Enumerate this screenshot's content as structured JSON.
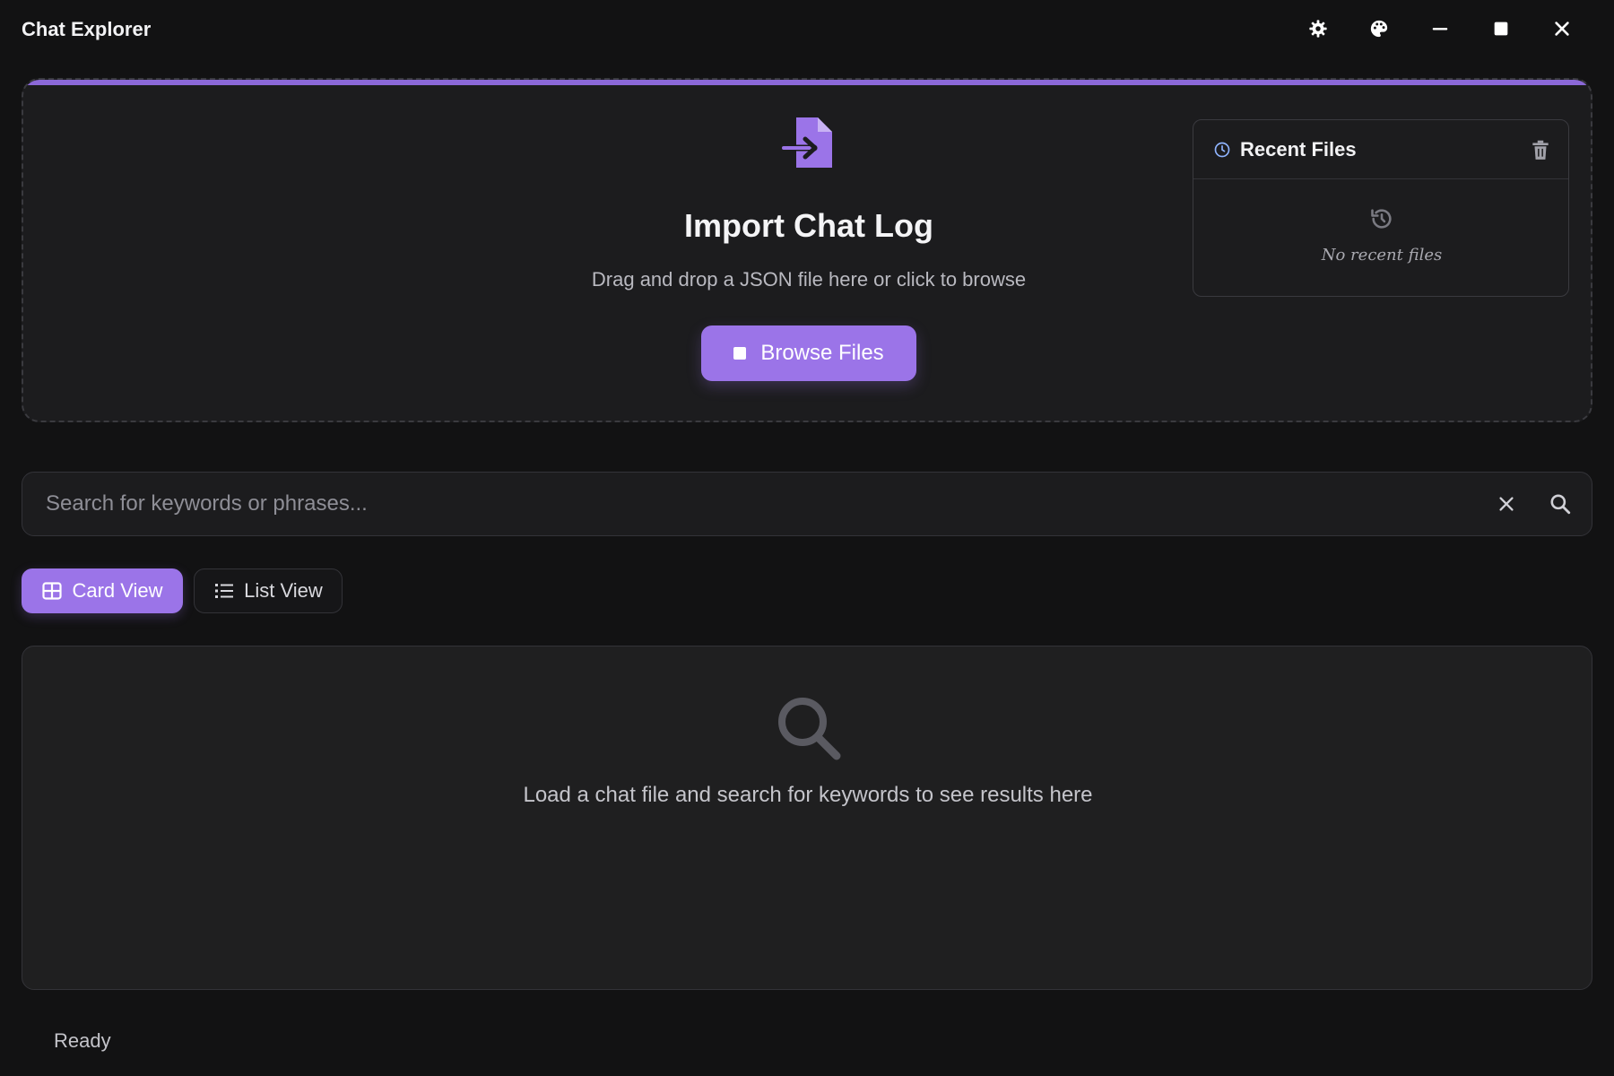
{
  "window": {
    "title": "Chat Explorer",
    "controls": [
      "settings-icon",
      "palette-icon",
      "minimize-icon",
      "maximize-icon",
      "close-icon"
    ]
  },
  "import": {
    "title": "Import Chat Log",
    "subtitle": "Drag and drop a JSON file here or click to browse",
    "browse_label": "Browse Files",
    "accent_color": "#9b74e8"
  },
  "recent": {
    "title": "Recent Files",
    "empty_text": "No recent files"
  },
  "search": {
    "placeholder": "Search for keywords or phrases...",
    "value": ""
  },
  "views": {
    "card_label": "Card View",
    "list_label": "List View",
    "active": "card"
  },
  "results": {
    "empty_text": "Load a chat file and search for keywords to see results here"
  },
  "status": {
    "text": "Ready"
  }
}
